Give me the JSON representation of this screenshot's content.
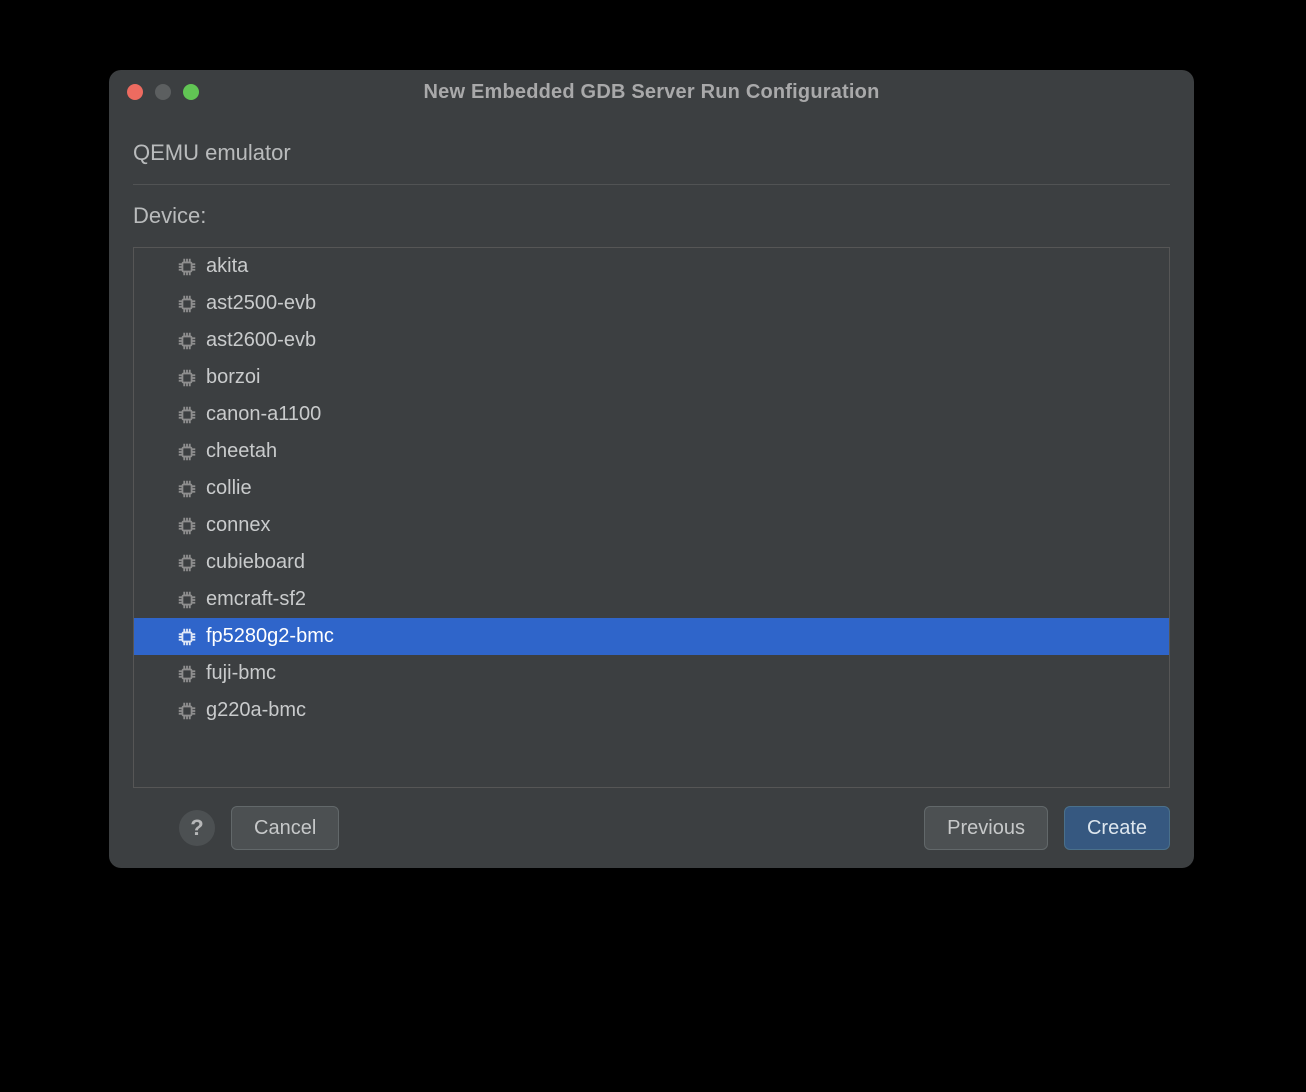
{
  "window": {
    "title": "New Embedded GDB Server Run Configuration",
    "subtitle": "QEMU emulator"
  },
  "device_section": {
    "label": "Device:",
    "selected_index": 10,
    "items": [
      {
        "label": "akita"
      },
      {
        "label": "ast2500-evb"
      },
      {
        "label": "ast2600-evb"
      },
      {
        "label": "borzoi"
      },
      {
        "label": "canon-a1100"
      },
      {
        "label": "cheetah"
      },
      {
        "label": "collie"
      },
      {
        "label": "connex"
      },
      {
        "label": "cubieboard"
      },
      {
        "label": "emcraft-sf2"
      },
      {
        "label": "fp5280g2-bmc"
      },
      {
        "label": "fuji-bmc"
      },
      {
        "label": "g220a-bmc"
      }
    ]
  },
  "footer": {
    "help_label": "?",
    "cancel_label": "Cancel",
    "previous_label": "Previous",
    "create_label": "Create"
  }
}
